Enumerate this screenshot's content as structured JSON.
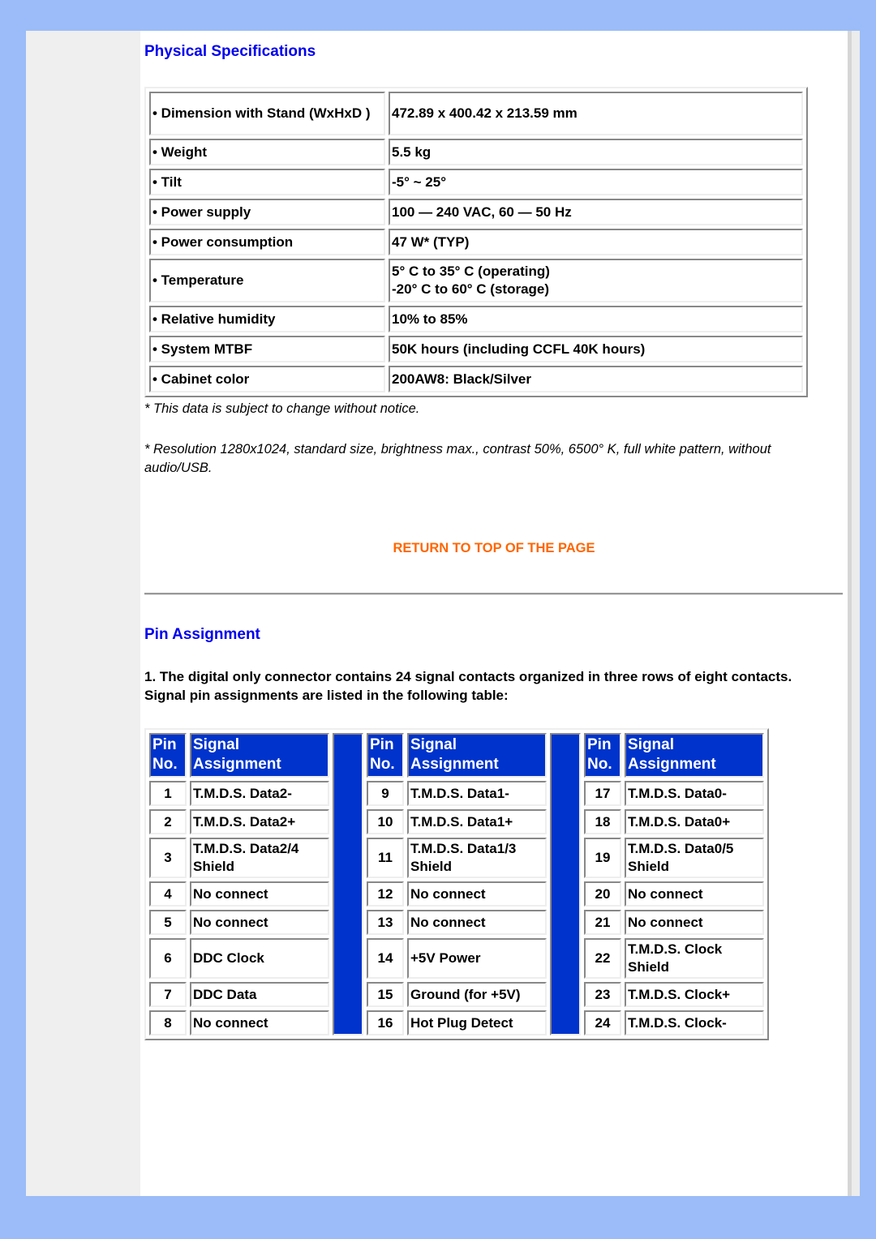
{
  "physical": {
    "title": "Physical Specifications",
    "rows": [
      {
        "label": "• Dimension with Stand (WxHxD )",
        "value": "472.89 x 400.42 x 213.59 mm"
      },
      {
        "label": "• Weight",
        "value": "5.5 kg"
      },
      {
        "label": "• Tilt",
        "value": "-5° ~ 25°"
      },
      {
        "label": "• Power supply",
        "value": "100 — 240 VAC, 60 — 50 Hz"
      },
      {
        "label": "• Power consumption",
        "value": "47 W* (TYP)"
      },
      {
        "label": "• Temperature",
        "value_line1": "5° C to 35° C (operating)",
        "value_line2": "-20° C to 60° C (storage)"
      },
      {
        "label": "• Relative humidity",
        "value": "10% to 85%"
      },
      {
        "label": "• System MTBF",
        "value": "50K hours (including CCFL 40K hours)"
      },
      {
        "label": "• Cabinet color",
        "value": "200AW8: Black/Silver"
      }
    ],
    "note1": "* This data is subject to change without notice.",
    "note2": "* Resolution 1280x1024, standard size, brightness max., contrast 50%, 6500° K, full white pattern, without audio/USB."
  },
  "return_link": "RETURN TO TOP OF THE PAGE",
  "pin_assignment": {
    "title": "Pin Assignment",
    "intro": "1. The digital only connector contains 24 signal contacts organized in three rows of eight contacts. Signal pin assignments are listed in the following table:",
    "header": {
      "pin_line1": "Pin",
      "pin_line2": "No.",
      "signal_line1": "Signal",
      "signal_line2": "Assignment"
    },
    "pins": [
      {
        "no": "1",
        "signal": "T.M.D.S. Data2-"
      },
      {
        "no": "2",
        "signal": "T.M.D.S. Data2+"
      },
      {
        "no": "3",
        "signal": "T.M.D.S. Data2/4 Shield"
      },
      {
        "no": "4",
        "signal": "No connect"
      },
      {
        "no": "5",
        "signal": "No connect"
      },
      {
        "no": "6",
        "signal": "DDC Clock"
      },
      {
        "no": "7",
        "signal": "DDC Data"
      },
      {
        "no": "8",
        "signal": "No connect"
      },
      {
        "no": "9",
        "signal": "T.M.D.S. Data1-"
      },
      {
        "no": "10",
        "signal": "T.M.D.S. Data1+"
      },
      {
        "no": "11",
        "signal": "T.M.D.S. Data1/3 Shield"
      },
      {
        "no": "12",
        "signal": "No connect"
      },
      {
        "no": "13",
        "signal": "No connect"
      },
      {
        "no": "14",
        "signal": "+5V Power"
      },
      {
        "no": "15",
        "signal": "Ground (for +5V)"
      },
      {
        "no": "16",
        "signal": "Hot Plug Detect"
      },
      {
        "no": "17",
        "signal": "T.M.D.S. Data0-"
      },
      {
        "no": "18",
        "signal": "T.M.D.S. Data0+"
      },
      {
        "no": "19",
        "signal": "T.M.D.S. Data0/5 Shield"
      },
      {
        "no": "20",
        "signal": "No connect"
      },
      {
        "no": "21",
        "signal": "No connect"
      },
      {
        "no": "22",
        "signal": "T.M.D.S. Clock Shield"
      },
      {
        "no": "23",
        "signal": "T.M.D.S. Clock+"
      },
      {
        "no": "24",
        "signal": "T.M.D.S. Clock-"
      }
    ]
  },
  "colors": {
    "heading_blue": "#0000ee",
    "table_header_blue": "#0033cc",
    "link_orange": "#ff6600",
    "page_background": "#9bbcf8"
  }
}
